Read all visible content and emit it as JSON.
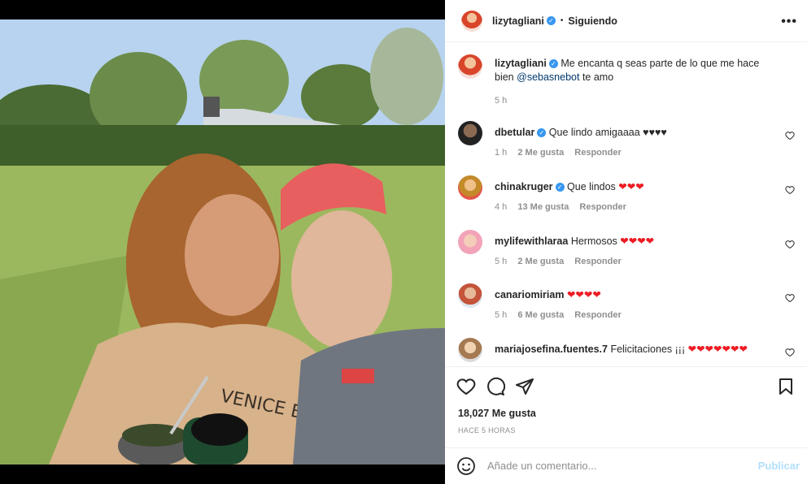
{
  "post": {
    "author": "lizytagliani",
    "follow_state": "Siguiendo",
    "bullet": "•",
    "caption_text": "Me encanta q seas parte de lo que me hace bien",
    "caption_mention": "@sebasnebot",
    "caption_tail": "te amo",
    "caption_time": "5 h",
    "likes": "18,027 Me gusta",
    "posted": "HACE 5 HORAS"
  },
  "comments": [
    {
      "user": "dbetular",
      "verified": true,
      "text": "Que lindo amigaaaa ♥♥♥♥",
      "time": "1 h",
      "likes": "2 Me gusta",
      "reply": "Responder"
    },
    {
      "user": "chinakruger",
      "verified": true,
      "text": "Que lindos",
      "hearts": "❤❤❤",
      "time": "4 h",
      "likes": "13 Me gusta",
      "reply": "Responder"
    },
    {
      "user": "mylifewithlaraa",
      "verified": false,
      "text": "Hermosos",
      "hearts": "❤❤❤❤",
      "time": "5 h",
      "likes": "2 Me gusta",
      "reply": "Responder"
    },
    {
      "user": "canariomiriam",
      "verified": false,
      "text": "",
      "hearts": "❤❤❤❤",
      "time": "5 h",
      "likes": "6 Me gusta",
      "reply": "Responder"
    },
    {
      "user": "mariajosefina.fuentes.7",
      "verified": false,
      "text": "Felicitaciones ¡¡¡",
      "hearts": "❤❤❤❤❤❤❤",
      "time": "",
      "likes": "",
      "reply": ""
    }
  ],
  "composer": {
    "placeholder": "Añade un comentario...",
    "publish": "Publicar"
  },
  "icons": [
    "more-options-icon",
    "heart-icon",
    "comment-icon",
    "share-icon",
    "save-icon",
    "emoji-icon",
    "verified-icon"
  ],
  "colors": {
    "verified": "#3897f0",
    "heart": "#ed1c24",
    "publish_disabled": "#b2dffc"
  }
}
